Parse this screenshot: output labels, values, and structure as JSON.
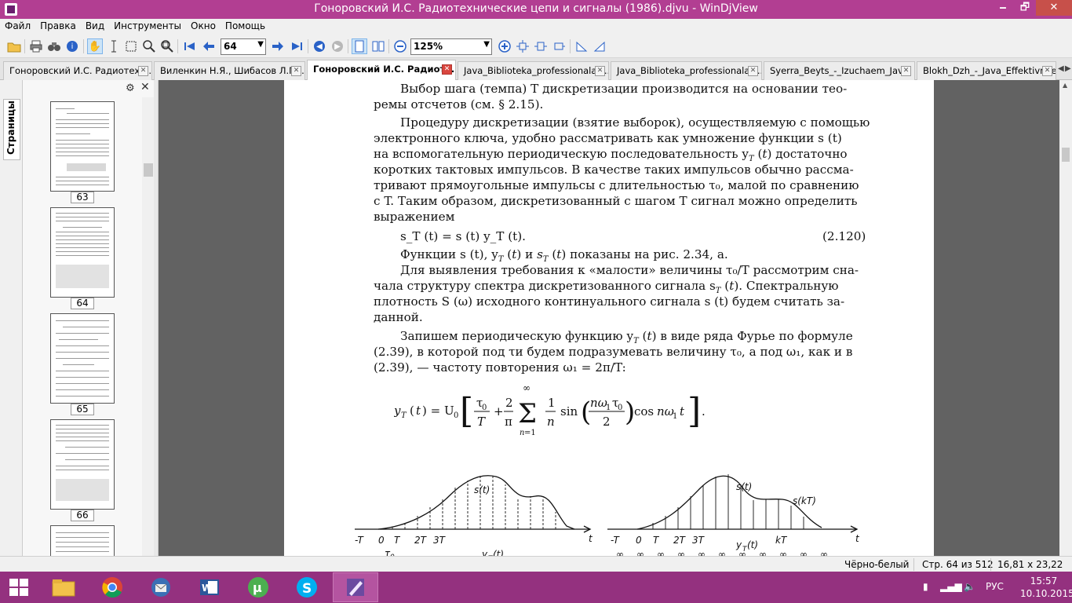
{
  "window": {
    "title": "Гоноровский И.С. Радиотехнические цепи и сигналы (1986).djvu - WinDjView",
    "minimize": "🗕",
    "maximize": "🗗",
    "close": "✕"
  },
  "menu": [
    "Файл",
    "Правка",
    "Вид",
    "Инструменты",
    "Окно",
    "Помощь"
  ],
  "toolbar": {
    "page_value": "64",
    "zoom_value": "125%"
  },
  "tabs": [
    {
      "label": "Гоноровский И.С. Радиотехн...",
      "active": false
    },
    {
      "label": "Виленкин Н.Я., Шибасов Л.П....",
      "active": false
    },
    {
      "label": "Гоноровский И.С. Радиоте...",
      "active": true
    },
    {
      "label": "Java_Biblioteka_professionala_...",
      "active": false
    },
    {
      "label": "Java_Biblioteka_professionala_...",
      "active": false
    },
    {
      "label": "Syerra_Beyts_-_Izuchaem_Jav...",
      "active": false
    },
    {
      "label": "Blokh_Dzh_-_Java_Effektivnoe...",
      "active": false
    }
  ],
  "sidebar": {
    "tab_label": "Страницы",
    "thumbnails": [
      {
        "page": "63"
      },
      {
        "page": "64"
      },
      {
        "page": "65"
      },
      {
        "page": "66"
      }
    ]
  },
  "document": {
    "lines": [
      "Выбор шага (темпа) T дискретизации производится на основании тео-",
      "ремы отсчетов (см. § 2.15).",
      "Процедуру дискретизации (взятие выборок), осуществляемую с помощью",
      "электронного ключа, удобно рассматривать как умножение функции s (t)",
      "на вспомогательную периодическую последовательность y",
      "коротких тактовых импульсов. В качестве таких импульсов обычно рассма-",
      "тривают прямоугольные импульсы с длительностью τ₀, малой по сравнению",
      "с T. Таким образом, дискретизованный с шагом T сигнал можно определить",
      "выражением",
      "Функции s (t), y",
      "Для выявления требования к «малости» величины τ₀/T рассмотрим сна-",
      "чала структуру спектра дискретизованного сигнала s",
      "плотность S (ω) исходного континуального сигнала s (t) будем считать за-",
      "данной.",
      "Запишем периодическую функцию y",
      "(2.39), в которой под τи будем подразумевать величину τ₀, а под ω₁, как и в",
      "(2.39), — частоту повторения ω₁ = 2π/T:"
    ],
    "eq_number": "(2.120)",
    "eq_120": "s_T (t) = s (t) y_T (t).",
    "fig_caption_ref": "рис. 2.34, а."
  },
  "status": {
    "mode": "Чёрно-белый",
    "page": "Стр. 64 из 512",
    "size": "16,81 x 23,22 см"
  },
  "taskbar": {
    "lang": "РУС",
    "time": "15:57",
    "date": "10.10.2015"
  }
}
